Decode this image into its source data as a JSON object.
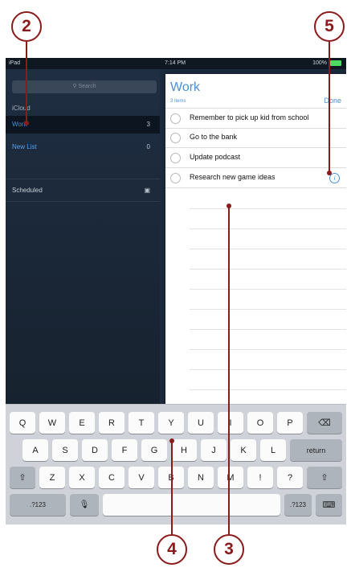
{
  "callouts": {
    "c2": "2",
    "c3": "3",
    "c4": "4",
    "c5": "5"
  },
  "status": {
    "left": "iPad",
    "time": "7:14 PM",
    "battery": "100%"
  },
  "sidebar": {
    "search_placeholder": "Search",
    "account": "iCloud",
    "lists": [
      {
        "name": "Work",
        "count": "3"
      },
      {
        "name": "New List",
        "count": "0"
      }
    ],
    "scheduled": "Scheduled"
  },
  "list": {
    "title": "Work",
    "subtitle": "3 items",
    "done": "Done",
    "items": [
      "Remember to pick up kid from school",
      "Go to the bank",
      "Update podcast",
      "Research new game ideas"
    ],
    "info_glyph": "i"
  },
  "keyboard": {
    "row1": [
      "Q",
      "W",
      "E",
      "R",
      "T",
      "Y",
      "U",
      "I",
      "O",
      "P"
    ],
    "row2": [
      "A",
      "S",
      "D",
      "F",
      "G",
      "H",
      "J",
      "K",
      "L"
    ],
    "row3": [
      "Z",
      "X",
      "C",
      "V",
      "B",
      "N",
      "M",
      "!",
      "?"
    ],
    "backspace": "⌫",
    "return": "return",
    "shift": "⇧",
    "numbers": ".?123",
    "mic": "🎙",
    "hide": "⌨"
  },
  "colors": {
    "accent": "#4a90d9",
    "callout": "#8b1a1a"
  }
}
